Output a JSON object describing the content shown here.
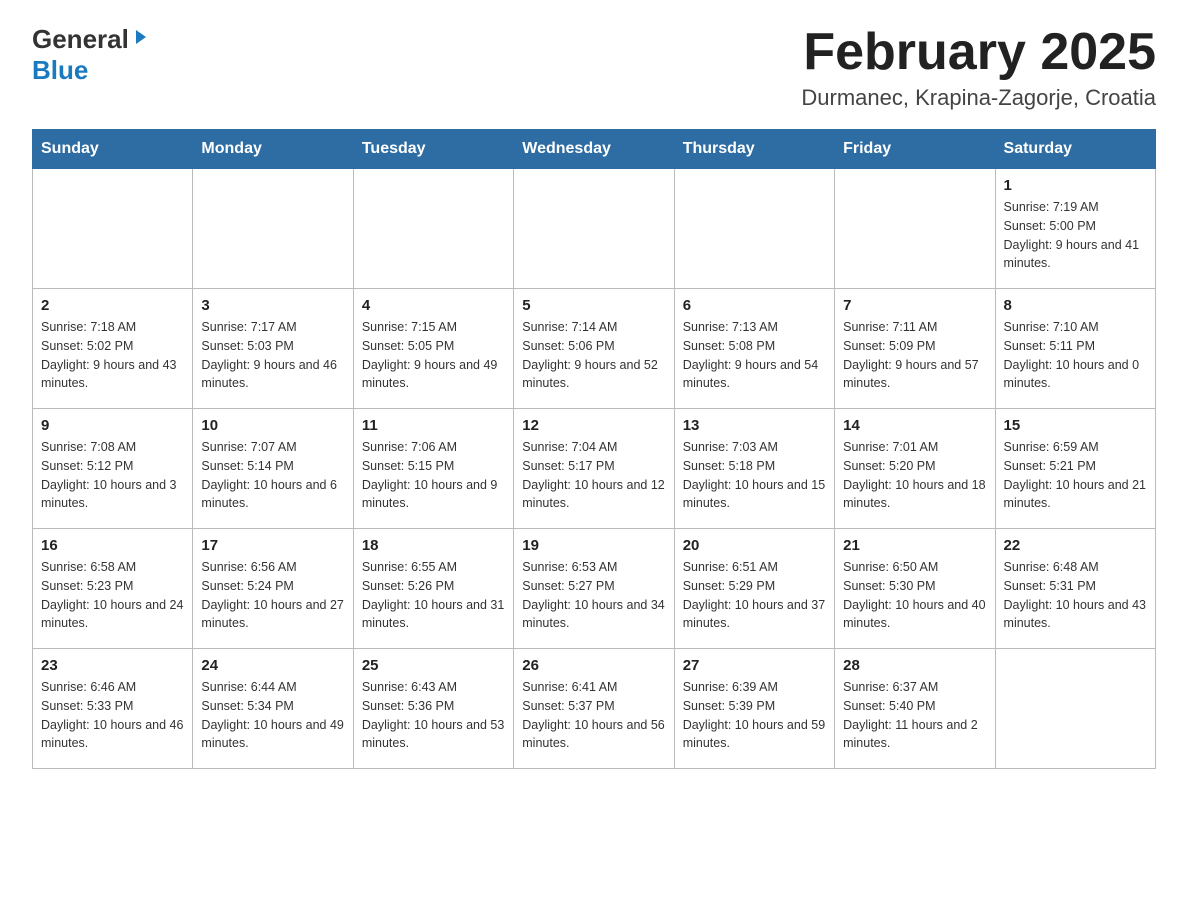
{
  "header": {
    "logo_general": "General",
    "logo_blue": "Blue",
    "title": "February 2025",
    "subtitle": "Durmanec, Krapina-Zagorje, Croatia"
  },
  "days_of_week": [
    "Sunday",
    "Monday",
    "Tuesday",
    "Wednesday",
    "Thursday",
    "Friday",
    "Saturday"
  ],
  "weeks": [
    {
      "days": [
        {
          "number": "",
          "info": ""
        },
        {
          "number": "",
          "info": ""
        },
        {
          "number": "",
          "info": ""
        },
        {
          "number": "",
          "info": ""
        },
        {
          "number": "",
          "info": ""
        },
        {
          "number": "",
          "info": ""
        },
        {
          "number": "1",
          "info": "Sunrise: 7:19 AM\nSunset: 5:00 PM\nDaylight: 9 hours and 41 minutes."
        }
      ]
    },
    {
      "days": [
        {
          "number": "2",
          "info": "Sunrise: 7:18 AM\nSunset: 5:02 PM\nDaylight: 9 hours and 43 minutes."
        },
        {
          "number": "3",
          "info": "Sunrise: 7:17 AM\nSunset: 5:03 PM\nDaylight: 9 hours and 46 minutes."
        },
        {
          "number": "4",
          "info": "Sunrise: 7:15 AM\nSunset: 5:05 PM\nDaylight: 9 hours and 49 minutes."
        },
        {
          "number": "5",
          "info": "Sunrise: 7:14 AM\nSunset: 5:06 PM\nDaylight: 9 hours and 52 minutes."
        },
        {
          "number": "6",
          "info": "Sunrise: 7:13 AM\nSunset: 5:08 PM\nDaylight: 9 hours and 54 minutes."
        },
        {
          "number": "7",
          "info": "Sunrise: 7:11 AM\nSunset: 5:09 PM\nDaylight: 9 hours and 57 minutes."
        },
        {
          "number": "8",
          "info": "Sunrise: 7:10 AM\nSunset: 5:11 PM\nDaylight: 10 hours and 0 minutes."
        }
      ]
    },
    {
      "days": [
        {
          "number": "9",
          "info": "Sunrise: 7:08 AM\nSunset: 5:12 PM\nDaylight: 10 hours and 3 minutes."
        },
        {
          "number": "10",
          "info": "Sunrise: 7:07 AM\nSunset: 5:14 PM\nDaylight: 10 hours and 6 minutes."
        },
        {
          "number": "11",
          "info": "Sunrise: 7:06 AM\nSunset: 5:15 PM\nDaylight: 10 hours and 9 minutes."
        },
        {
          "number": "12",
          "info": "Sunrise: 7:04 AM\nSunset: 5:17 PM\nDaylight: 10 hours and 12 minutes."
        },
        {
          "number": "13",
          "info": "Sunrise: 7:03 AM\nSunset: 5:18 PM\nDaylight: 10 hours and 15 minutes."
        },
        {
          "number": "14",
          "info": "Sunrise: 7:01 AM\nSunset: 5:20 PM\nDaylight: 10 hours and 18 minutes."
        },
        {
          "number": "15",
          "info": "Sunrise: 6:59 AM\nSunset: 5:21 PM\nDaylight: 10 hours and 21 minutes."
        }
      ]
    },
    {
      "days": [
        {
          "number": "16",
          "info": "Sunrise: 6:58 AM\nSunset: 5:23 PM\nDaylight: 10 hours and 24 minutes."
        },
        {
          "number": "17",
          "info": "Sunrise: 6:56 AM\nSunset: 5:24 PM\nDaylight: 10 hours and 27 minutes."
        },
        {
          "number": "18",
          "info": "Sunrise: 6:55 AM\nSunset: 5:26 PM\nDaylight: 10 hours and 31 minutes."
        },
        {
          "number": "19",
          "info": "Sunrise: 6:53 AM\nSunset: 5:27 PM\nDaylight: 10 hours and 34 minutes."
        },
        {
          "number": "20",
          "info": "Sunrise: 6:51 AM\nSunset: 5:29 PM\nDaylight: 10 hours and 37 minutes."
        },
        {
          "number": "21",
          "info": "Sunrise: 6:50 AM\nSunset: 5:30 PM\nDaylight: 10 hours and 40 minutes."
        },
        {
          "number": "22",
          "info": "Sunrise: 6:48 AM\nSunset: 5:31 PM\nDaylight: 10 hours and 43 minutes."
        }
      ]
    },
    {
      "days": [
        {
          "number": "23",
          "info": "Sunrise: 6:46 AM\nSunset: 5:33 PM\nDaylight: 10 hours and 46 minutes."
        },
        {
          "number": "24",
          "info": "Sunrise: 6:44 AM\nSunset: 5:34 PM\nDaylight: 10 hours and 49 minutes."
        },
        {
          "number": "25",
          "info": "Sunrise: 6:43 AM\nSunset: 5:36 PM\nDaylight: 10 hours and 53 minutes."
        },
        {
          "number": "26",
          "info": "Sunrise: 6:41 AM\nSunset: 5:37 PM\nDaylight: 10 hours and 56 minutes."
        },
        {
          "number": "27",
          "info": "Sunrise: 6:39 AM\nSunset: 5:39 PM\nDaylight: 10 hours and 59 minutes."
        },
        {
          "number": "28",
          "info": "Sunrise: 6:37 AM\nSunset: 5:40 PM\nDaylight: 11 hours and 2 minutes."
        },
        {
          "number": "",
          "info": ""
        }
      ]
    }
  ]
}
